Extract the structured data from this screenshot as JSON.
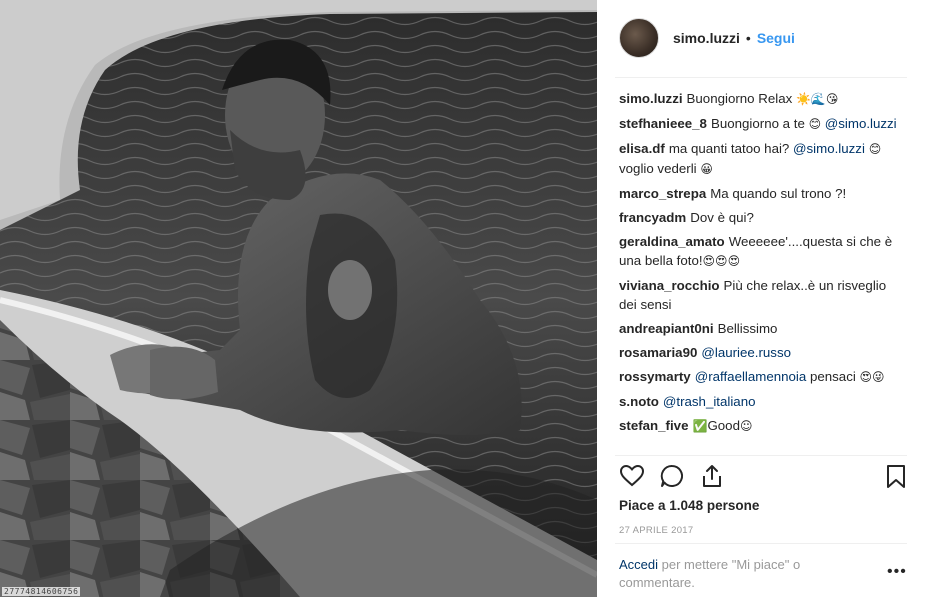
{
  "header": {
    "username": "simo.luzzi",
    "separator": "•",
    "follow_label": "Segui"
  },
  "photo": {
    "caption_id": "27774814606756"
  },
  "comments": [
    {
      "user": "simo.luzzi",
      "text": "Buongiorno Relax ",
      "emoji": "☀️🌊😘"
    },
    {
      "user": "stefhanieee_8",
      "text": "Buongiorno a te ",
      "emoji": "😊",
      "mention": " @simo.luzzi"
    },
    {
      "user": "elisa.df",
      "text": "ma quanti tatoo hai? ",
      "mention": "@simo.luzzi",
      "emoji": " 😊",
      "text2": " voglio vederli ",
      "emoji2": "😀"
    },
    {
      "user": "marco_strepa",
      "text": "Ma quando sul trono ?!"
    },
    {
      "user": "francyadm",
      "text": "Dov è qui?"
    },
    {
      "user": "geraldina_amato",
      "text": "Weeeeee'....questa si che è una bella foto!",
      "emoji": "😍😍😍"
    },
    {
      "user": "viviana_rocchio",
      "text": "Più che relax..è un risveglio dei sensi"
    },
    {
      "user": "andreapiant0ni",
      "text": "Bellissimo"
    },
    {
      "user": "rosamaria90",
      "mention": "@lauriee.russo"
    },
    {
      "user": "rossymarty",
      "mention": "@raffaellamennoia",
      "text": " pensaci ",
      "emoji": "😍😜"
    },
    {
      "user": "s.noto",
      "mention": "@trash_italiano"
    },
    {
      "user": "stefan_five",
      "emoji": "✅",
      "text": "Good",
      "emoji2": "☺"
    }
  ],
  "actions": {
    "like_icon": "heart-icon",
    "comment_icon": "comment-icon",
    "share_icon": "share-icon",
    "save_icon": "bookmark-icon"
  },
  "likes_text": "Piace a 1.048 persone",
  "date_text": "27 APRILE 2017",
  "login": {
    "link": "Accedi",
    "text": " per mettere \"Mi piace\" o commentare."
  },
  "more_label": "•••",
  "colors": {
    "link": "#3897f0",
    "mention": "#003569",
    "text": "#262626",
    "muted": "#999999"
  }
}
